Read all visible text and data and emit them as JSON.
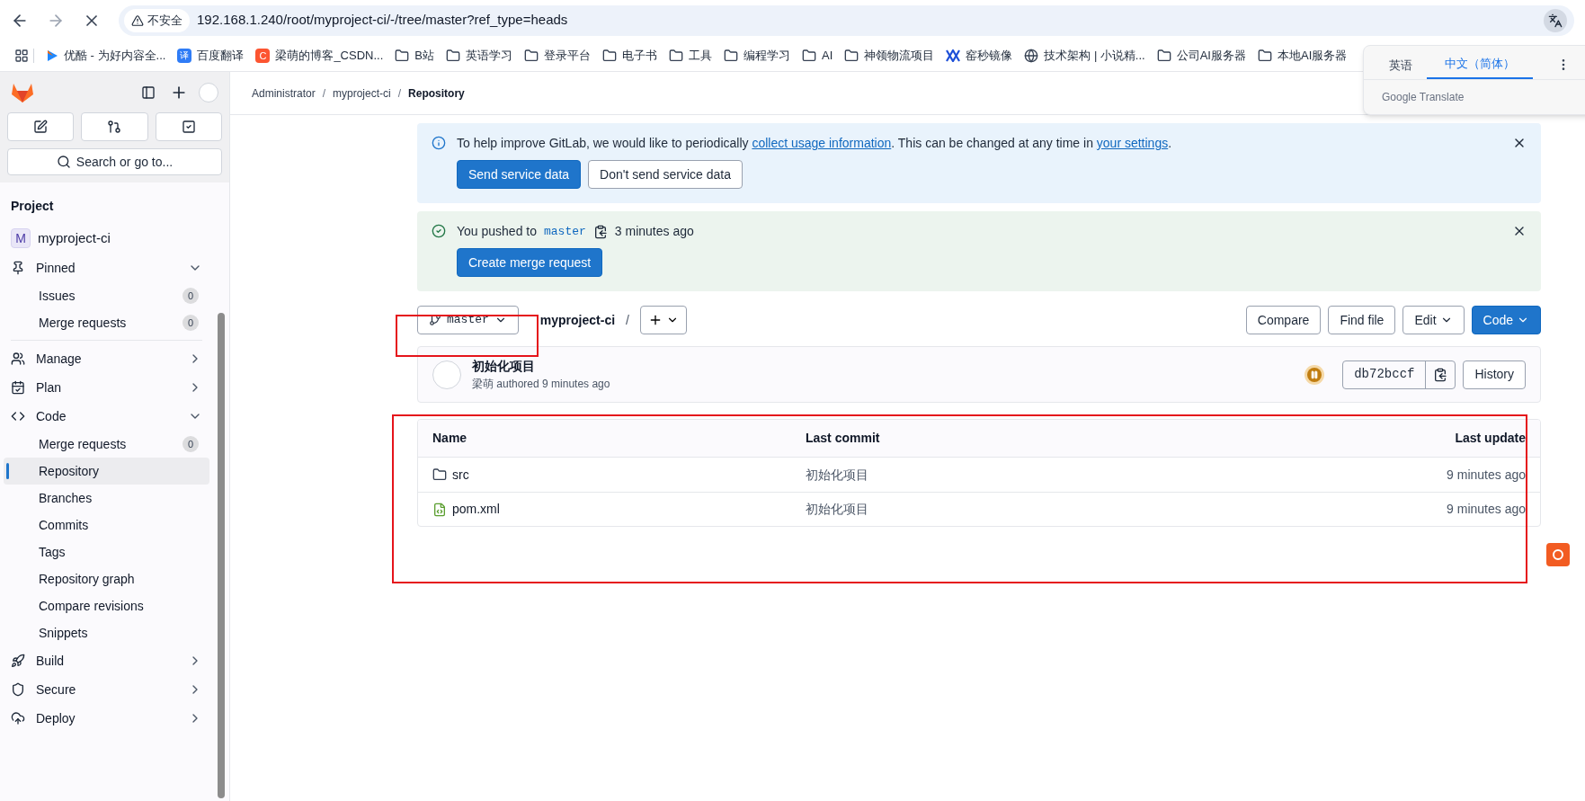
{
  "browser": {
    "security": "不安全",
    "url": "192.168.1.240/root/myproject-ci/-/tree/master?ref_type=heads",
    "bookmarks": [
      {
        "kind": "video",
        "label": "优酷 - 为好内容全..."
      },
      {
        "kind": "translate",
        "label": "百度翻译",
        "glyph": "译"
      },
      {
        "kind": "csdn",
        "label": "梁萌的博客_CSDN...",
        "glyph": "C"
      },
      {
        "kind": "folder",
        "label": "B站"
      },
      {
        "kind": "folder",
        "label": "英语学习"
      },
      {
        "kind": "folder",
        "label": "登录平台"
      },
      {
        "kind": "folder",
        "label": "电子书"
      },
      {
        "kind": "folder",
        "label": "工具"
      },
      {
        "kind": "folder",
        "label": "编程学习"
      },
      {
        "kind": "folder",
        "label": "AI"
      },
      {
        "kind": "folder",
        "label": "神领物流项目"
      },
      {
        "kind": "mirror",
        "label": "窑秒镜像"
      },
      {
        "kind": "globe",
        "label": "技术架构 | 小说精..."
      },
      {
        "kind": "folder",
        "label": "公司AI服务器"
      },
      {
        "kind": "folder",
        "label": "本地AI服务器"
      }
    ]
  },
  "translate_popup": {
    "tabs": [
      {
        "label": "英语",
        "selected": false
      },
      {
        "label": "中文（简体）",
        "selected": true
      }
    ],
    "footer": "Google Translate"
  },
  "sidebar": {
    "search": "Search or go to...",
    "section": "Project",
    "project": {
      "avatar": "M",
      "name": "myproject-ci"
    },
    "items": [
      {
        "kind": "group",
        "label": "Pinned",
        "expanded": true,
        "children": [
          {
            "label": "Issues",
            "count": "0",
            "selected": false
          },
          {
            "label": "Merge requests",
            "count": "0",
            "selected": false
          }
        ]
      },
      {
        "kind": "divider"
      },
      {
        "kind": "group",
        "label": "Manage",
        "expanded": false
      },
      {
        "kind": "group",
        "label": "Plan",
        "expanded": false
      },
      {
        "kind": "group",
        "label": "Code",
        "expanded": true,
        "children": [
          {
            "label": "Merge requests",
            "count": "0",
            "selected": false
          },
          {
            "label": "Repository",
            "selected": true
          },
          {
            "label": "Branches",
            "selected": false
          },
          {
            "label": "Commits",
            "selected": false
          },
          {
            "label": "Tags",
            "selected": false
          },
          {
            "label": "Repository graph",
            "selected": false
          },
          {
            "label": "Compare revisions",
            "selected": false
          },
          {
            "label": "Snippets",
            "selected": false
          }
        ]
      },
      {
        "kind": "group",
        "label": "Build",
        "expanded": false
      },
      {
        "kind": "group",
        "label": "Secure",
        "expanded": false
      },
      {
        "kind": "group",
        "label": "Deploy",
        "expanded": false
      }
    ]
  },
  "breadcrumb": {
    "separator": "/",
    "items": [
      "Administrator",
      "myproject-ci",
      "Repository"
    ]
  },
  "alerts": [
    {
      "kind": "info",
      "text": "To help improve GitLab, we would like to periodically",
      "link": "collect usage information",
      "text2": ". This can be changed at any time in",
      "link2": "your settings",
      "text3": ".",
      "buttons": [
        {
          "label": "Send service data",
          "primary": true
        },
        {
          "label": "Don't send service data",
          "primary": false
        }
      ]
    },
    {
      "kind": "success",
      "text": "You pushed to",
      "branch": "master",
      "time": "3 minutes ago",
      "buttons": [
        {
          "label": "Create merge request",
          "primary": true
        }
      ]
    }
  ],
  "toolbar": {
    "branch": "master",
    "project": "myproject-ci",
    "sep": "/",
    "actions": [
      {
        "label": "Compare",
        "primary": false,
        "caret": false
      },
      {
        "label": "Find file",
        "primary": false,
        "caret": false
      },
      {
        "label": "Edit",
        "primary": false,
        "caret": true
      },
      {
        "label": "Code",
        "primary": true,
        "caret": true
      }
    ]
  },
  "commit": {
    "title": "初始化项目",
    "author": "梁萌",
    "meta": "authored 9 minutes ago",
    "sha": "db72bccf",
    "history": "History"
  },
  "table": {
    "columns": [
      "Name",
      "Last commit",
      "Last update"
    ],
    "rows": [
      {
        "kind": "folder",
        "name": "src",
        "commit": "初始化项目",
        "updated": "9 minutes ago"
      },
      {
        "kind": "file",
        "name": "pom.xml",
        "commit": "初始化项目",
        "updated": "9 minutes ago"
      }
    ]
  }
}
